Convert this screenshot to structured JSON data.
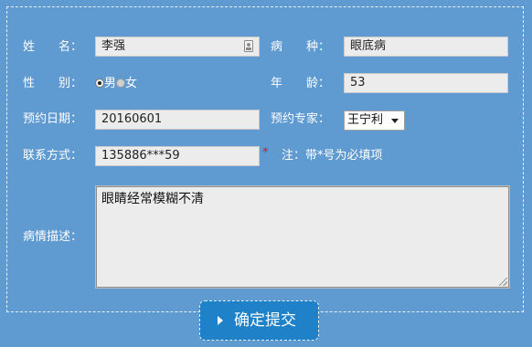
{
  "form": {
    "name": {
      "label_a": "姓",
      "label_b": "名：",
      "value": "李强",
      "icon": "id-card-icon"
    },
    "disease": {
      "label_a": "病",
      "label_b": "种：",
      "value": "眼底病"
    },
    "gender": {
      "label_a": "性",
      "label_b": "别：",
      "options": [
        "男",
        "女"
      ],
      "selected": "男"
    },
    "age": {
      "label_a": "年",
      "label_b": "龄：",
      "value": "53"
    },
    "date": {
      "label": "预约日期：",
      "value": "20160601"
    },
    "expert": {
      "label": "预约专家：",
      "selected": "王宁利"
    },
    "contact": {
      "label": "联系方式：",
      "value": "135886***59"
    },
    "required_mark": "*",
    "note": "注：带*号为必填项",
    "description": {
      "label": "病情描述：",
      "value": "眼睛经常模糊不清"
    },
    "submit_label": "确定提交"
  },
  "colors": {
    "background": "#5f9ad0",
    "button": "#1f82c8",
    "required": "#d11a1a",
    "field": "#ececec"
  }
}
